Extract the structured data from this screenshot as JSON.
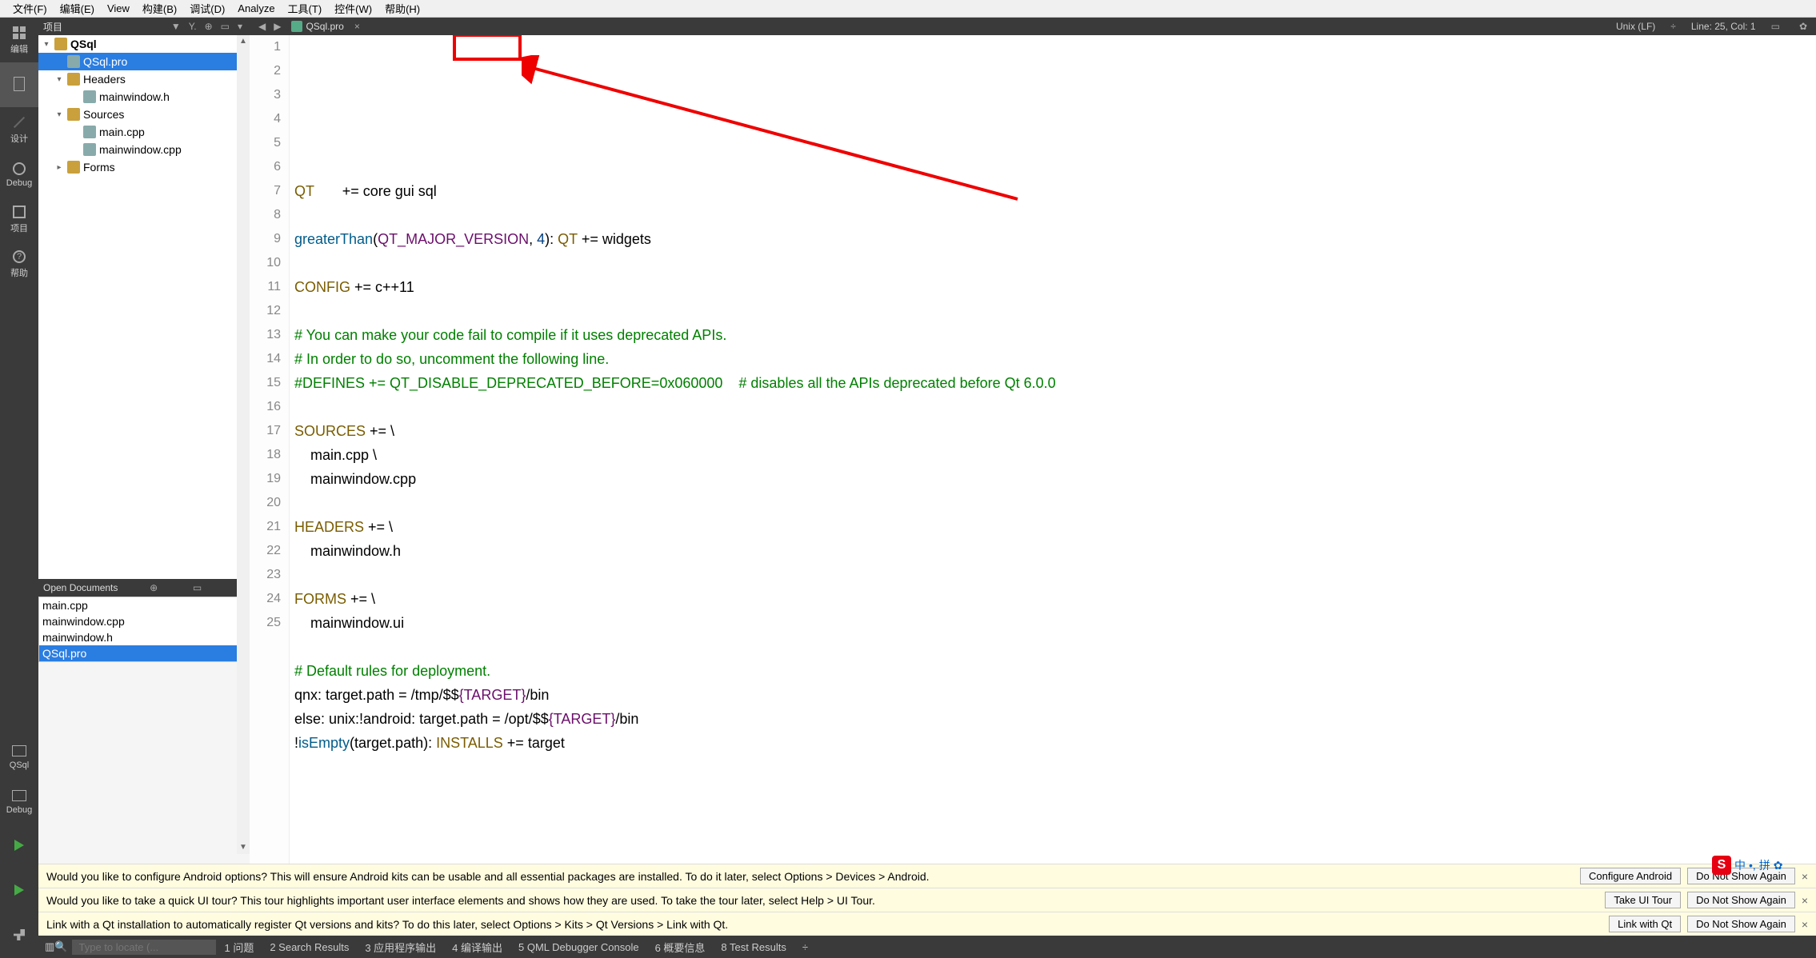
{
  "menu": {
    "file": "文件(F)",
    "edit": "编辑(E)",
    "view": "View",
    "build": "构建(B)",
    "debug": "调试(D)",
    "analyze": "Analyze",
    "tools": "工具(T)",
    "widgets": "控件(W)",
    "help": "帮助(H)"
  },
  "left_tools": {
    "edit": "编辑",
    "design": "设计",
    "debug": "Debug",
    "proj": "项目",
    "help": "帮助",
    "qsql": "QSql",
    "debug2": "Debug"
  },
  "proj_header": "项目",
  "tree": {
    "root": "QSql",
    "file_pro": "QSql.pro",
    "headers": "Headers",
    "header1": "mainwindow.h",
    "sources": "Sources",
    "src1": "main.cpp",
    "src2": "mainwindow.cpp",
    "forms": "Forms"
  },
  "open_docs_hdr": "Open Documents",
  "open_docs": [
    "main.cpp",
    "mainwindow.cpp",
    "mainwindow.h",
    "QSql.pro"
  ],
  "tab": {
    "name": "QSql.pro"
  },
  "ed_status": {
    "encoding": "Unix (LF)",
    "pos": "Line: 25, Col: 1"
  },
  "code_lines": [
    {
      "n": 1,
      "segs": [
        {
          "t": "QT       ",
          "c": "kw"
        },
        {
          "t": "+= core gui "
        },
        {
          "t": "sql"
        }
      ]
    },
    {
      "n": 2,
      "segs": []
    },
    {
      "n": 3,
      "segs": [
        {
          "t": "greaterThan",
          "c": "fn"
        },
        {
          "t": "("
        },
        {
          "t": "QT_MAJOR_VERSION",
          "c": "var"
        },
        {
          "t": ", "
        },
        {
          "t": "4",
          "c": "num"
        },
        {
          "t": "): "
        },
        {
          "t": "QT",
          "c": "kw"
        },
        {
          "t": " += widgets"
        }
      ]
    },
    {
      "n": 4,
      "segs": []
    },
    {
      "n": 5,
      "segs": [
        {
          "t": "CONFIG",
          "c": "kw"
        },
        {
          "t": " += c++11"
        }
      ]
    },
    {
      "n": 6,
      "segs": []
    },
    {
      "n": 7,
      "segs": [
        {
          "t": "# You can make your code fail to compile if it uses deprecated APIs.",
          "c": "cmt"
        }
      ]
    },
    {
      "n": 8,
      "segs": [
        {
          "t": "# In order to do so, uncomment the following line.",
          "c": "cmt"
        }
      ]
    },
    {
      "n": 9,
      "segs": [
        {
          "t": "#DEFINES += QT_DISABLE_DEPRECATED_BEFORE=0x060000    # disables all the APIs deprecated before Qt 6.0.0",
          "c": "cmt"
        }
      ]
    },
    {
      "n": 10,
      "segs": []
    },
    {
      "n": 11,
      "segs": [
        {
          "t": "SOURCES",
          "c": "kw"
        },
        {
          "t": " += \\"
        }
      ]
    },
    {
      "n": 12,
      "segs": [
        {
          "t": "    main.cpp \\"
        }
      ]
    },
    {
      "n": 13,
      "segs": [
        {
          "t": "    mainwindow.cpp"
        }
      ]
    },
    {
      "n": 14,
      "segs": []
    },
    {
      "n": 15,
      "segs": [
        {
          "t": "HEADERS",
          "c": "kw"
        },
        {
          "t": " += \\"
        }
      ]
    },
    {
      "n": 16,
      "segs": [
        {
          "t": "    mainwindow.h"
        }
      ]
    },
    {
      "n": 17,
      "segs": []
    },
    {
      "n": 18,
      "segs": [
        {
          "t": "FORMS",
          "c": "kw"
        },
        {
          "t": " += \\"
        }
      ]
    },
    {
      "n": 19,
      "segs": [
        {
          "t": "    mainwindow.ui"
        }
      ]
    },
    {
      "n": 20,
      "segs": []
    },
    {
      "n": 21,
      "segs": [
        {
          "t": "# Default rules for deployment.",
          "c": "cmt"
        }
      ]
    },
    {
      "n": 22,
      "segs": [
        {
          "t": "qnx: target.path = /tmp/$$"
        },
        {
          "t": "{TARGET}",
          "c": "str"
        },
        {
          "t": "/bin"
        }
      ]
    },
    {
      "n": 23,
      "segs": [
        {
          "t": "else: unix:!android: target.path = /opt/$$"
        },
        {
          "t": "{TARGET}",
          "c": "str"
        },
        {
          "t": "/bin"
        }
      ]
    },
    {
      "n": 24,
      "segs": [
        {
          "t": "!"
        },
        {
          "t": "isEmpty",
          "c": "fn"
        },
        {
          "t": "(target.path): "
        },
        {
          "t": "INSTALLS",
          "c": "kw"
        },
        {
          "t": " += target"
        }
      ]
    },
    {
      "n": 25,
      "segs": []
    }
  ],
  "notifs": [
    {
      "text": "Would you like to configure Android options? This will ensure Android kits can be usable and all essential packages are installed. To do it later, select Options > Devices > Android.",
      "btn1": "Configure Android",
      "btn2": "Do Not Show Again"
    },
    {
      "text": "Would you like to take a quick UI tour? This tour highlights important user interface elements and shows how they are used. To take the tour later, select Help > UI Tour.",
      "btn1": "Take UI Tour",
      "btn2": "Do Not Show Again"
    },
    {
      "text": "Link with a Qt installation to automatically register Qt versions and kits? To do this later, select Options > Kits > Qt Versions > Link with Qt.",
      "btn1": "Link with Qt",
      "btn2": "Do Not Show Again"
    }
  ],
  "statusbar": {
    "search_placeholder": "Type to locate (...",
    "panes": [
      "1 问题",
      "2 Search Results",
      "3 应用程序输出",
      "4 编译输出",
      "5 QML Debugger Console",
      "6 概要信息",
      "8 Test Results"
    ]
  },
  "ime": {
    "badge": "S",
    "lang": "中",
    "mode": "拼"
  }
}
